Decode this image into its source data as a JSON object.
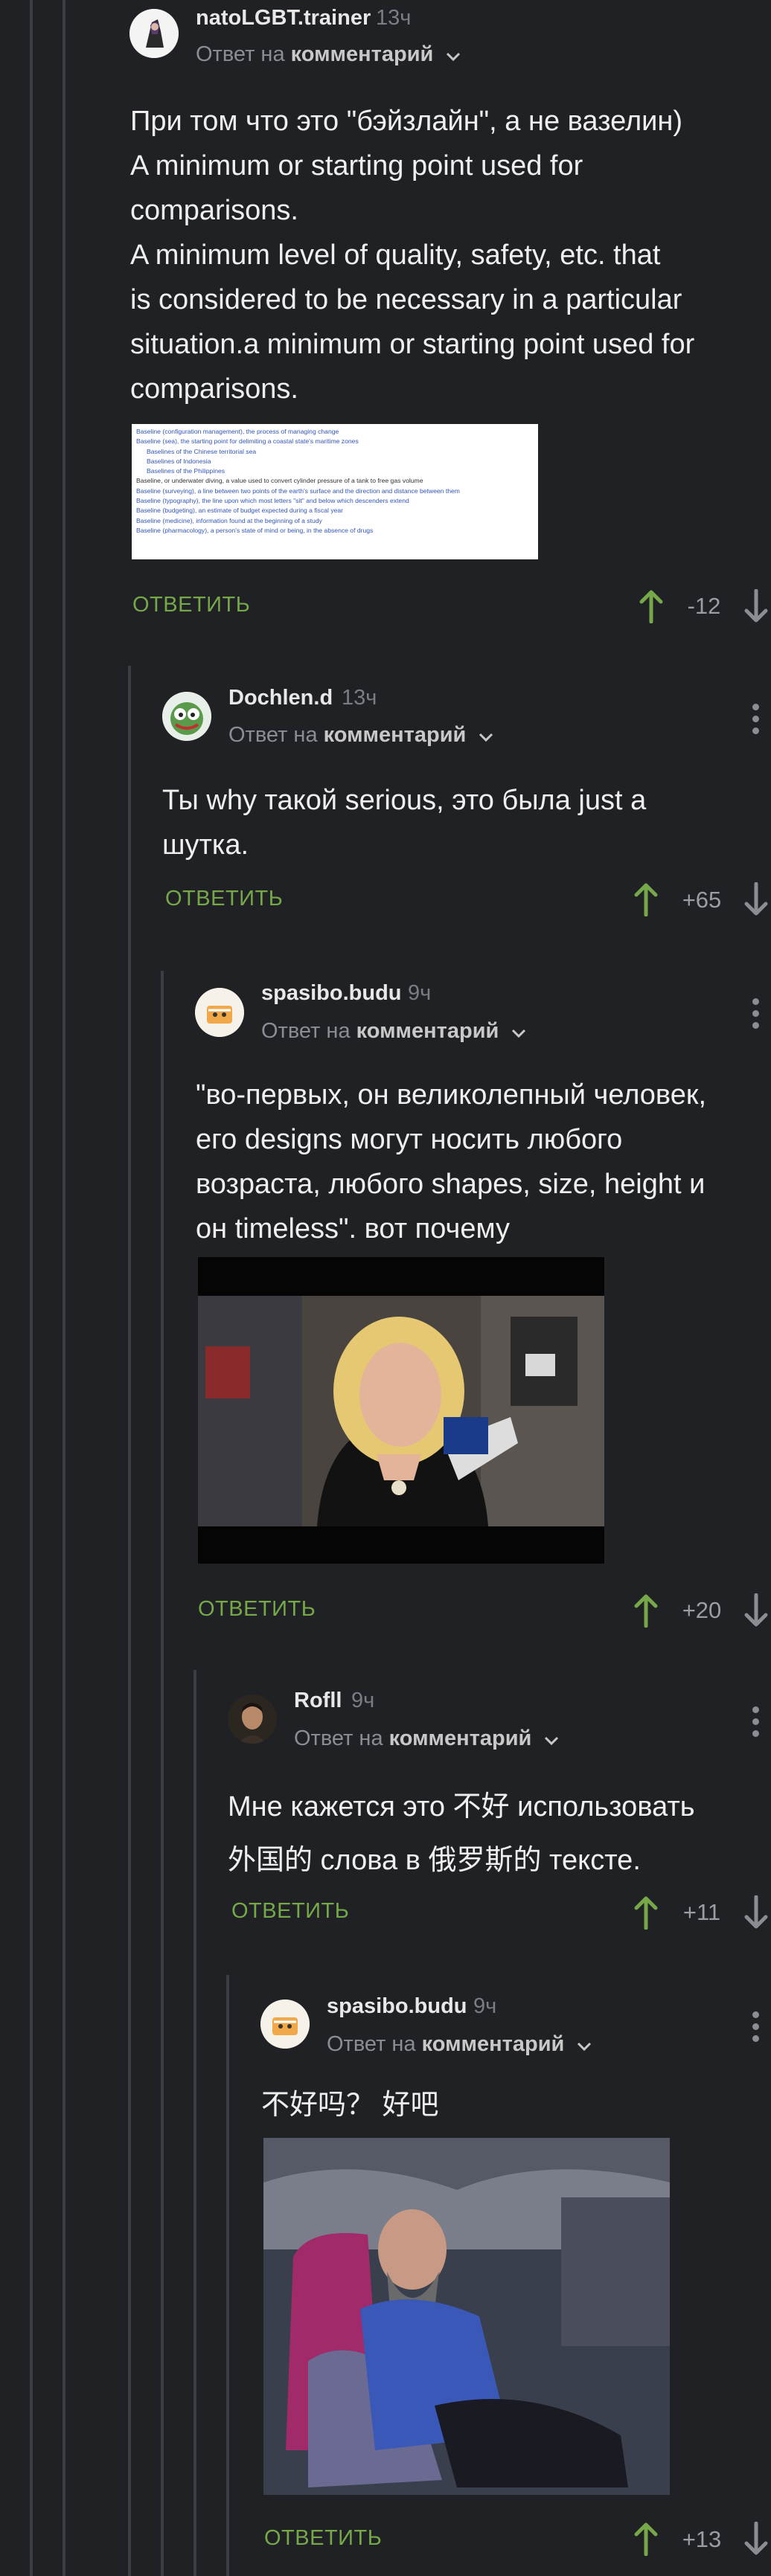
{
  "comments": [
    {
      "author": "natoLGBT.trainer",
      "time": "13ч",
      "reply_prefix": "Ответ на",
      "reply_target": "комментарий",
      "text_lines": [
        "При том что это \"бэйзлайн\", а не вазелин)",
        "A minimum or starting point used for",
        "comparisons.",
        "A minimum level of quality, safety, etc. that",
        "is considered to be necessary in a particular",
        "situation.a minimum or starting point used for",
        "comparisons."
      ],
      "reply_label": "ОТВЕТИТЬ",
      "score": "-12",
      "screenshot_lines": [
        "Baseline (configuration management), the process of managing change",
        "Baseline (sea), the starting point for delimiting a coastal state's maritime zones",
        "Baselines of the Chinese territorial sea",
        "Baselines of Indonesia",
        "Baselines of the Philippines",
        "Baseline, or underwater diving, a value used to convert cylinder pressure of a tank to free gas volume",
        "Baseline (surveying), a line between two points of the earth's surface and the direction and distance between them",
        "Baseline (typography), the line upon which most letters \"sit\" and below which descenders extend",
        "Baseline (budgeting), an estimate of budget expected during a fiscal year",
        "Baseline (medicine), information found at the beginning of a study",
        "Baseline (pharmacology), a person's state of mind or being, in the absence of drugs"
      ]
    },
    {
      "author": "Dochlen.d",
      "time": "13ч",
      "reply_prefix": "Ответ на",
      "reply_target": "комментарий",
      "text_lines": [
        "Ты why такой serious, это была just a",
        "шутка."
      ],
      "reply_label": "ОТВЕТИТЬ",
      "score": "+65"
    },
    {
      "author": "spasibo.budu",
      "time": "9ч",
      "reply_prefix": "Ответ на",
      "reply_target": "комментарий",
      "text_lines": [
        "\"во-первых, он великолепный человек,",
        "его designs могут носить любого",
        "возраста, любого shapes, size, height и",
        "он timeless\". вот почему"
      ],
      "reply_label": "ОТВЕТИТЬ",
      "score": "+20"
    },
    {
      "author": "Rofll",
      "time": "9ч",
      "reply_prefix": "Ответ на",
      "reply_target": "комментарий",
      "text_lines": [
        "Мне кажется это 不好 использовать",
        "外国的 слова в 俄罗斯的 тексте."
      ],
      "reply_label": "ОТВЕТИТЬ",
      "score": "+11"
    },
    {
      "author": "spasibo.budu",
      "time": "9ч",
      "reply_prefix": "Ответ на",
      "reply_target": "комментарий",
      "text_lines": [
        "不好吗？ 好吧"
      ],
      "reply_label": "ОТВЕТИТЬ",
      "score": "+13"
    }
  ],
  "colors": {
    "background": "#1f2124",
    "reply_green": "#76a84a",
    "upvote_green": "#76a84a",
    "muted": "#8a8d92"
  },
  "icons": [
    "more-options-icon",
    "chevron-down-icon",
    "upvote-arrow-icon",
    "downvote-arrow-icon"
  ]
}
